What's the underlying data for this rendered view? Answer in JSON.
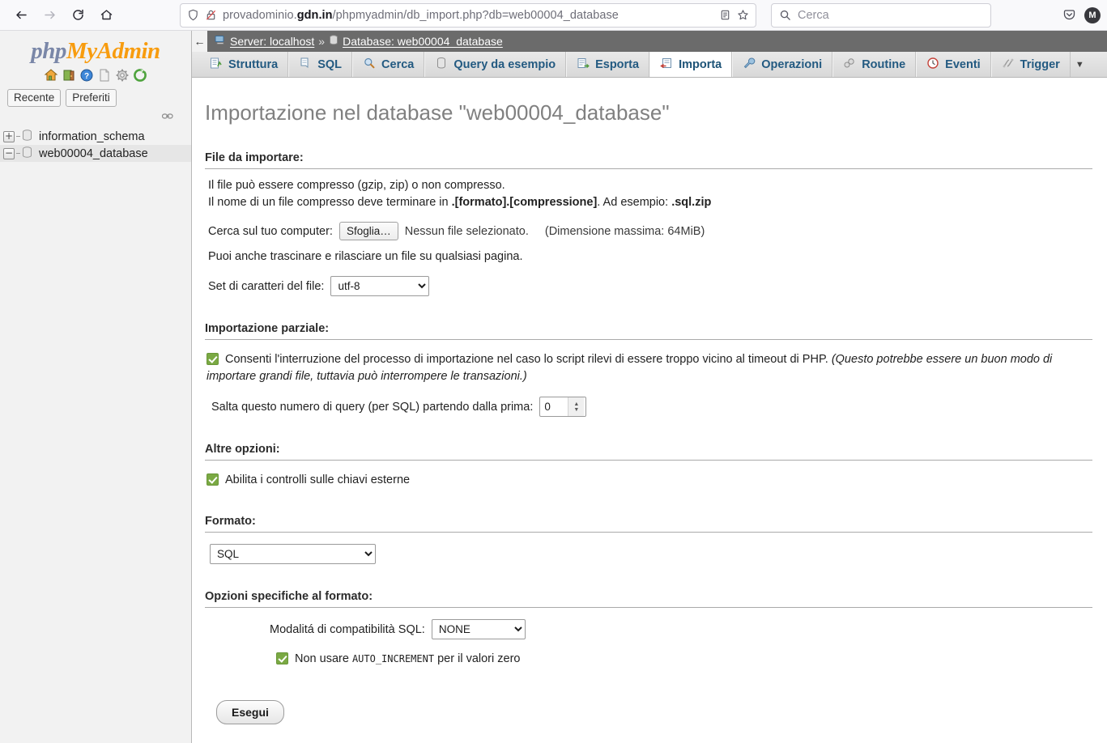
{
  "browser": {
    "back_icon": "arrow-left-icon",
    "forward_icon": "arrow-right-icon",
    "reload_icon": "reload-icon",
    "home_icon": "home-icon",
    "shield_icon": "shield-icon",
    "insecure_icon": "lock-crossed-icon",
    "url_prefix": "provadominio.",
    "url_domain": "gdn.in",
    "url_suffix": "/phpmyadmin/db_import.php?db=web00004_database",
    "reader_icon": "reader-view-icon",
    "bookmark_icon": "star-icon",
    "search_icon": "search-icon",
    "search_placeholder": "Cerca",
    "pocket_icon": "pocket-icon",
    "avatar_initial": "M"
  },
  "sidebar": {
    "logo_php": "php",
    "logo_myadmin": "MyAdmin",
    "nav_icons": [
      "home-icon",
      "logout-icon",
      "help-icon",
      "docs-icon",
      "settings-gear-icon",
      "refresh-icon"
    ],
    "quick_buttons": [
      {
        "label": "Recente"
      },
      {
        "label": "Preferiti"
      }
    ],
    "link_icon": "chain-link-icon",
    "databases": [
      {
        "name": "information_schema",
        "expander": "+",
        "selected": false
      },
      {
        "name": "web00004_database",
        "expander": "−",
        "selected": true
      }
    ]
  },
  "breadcrumb": {
    "back_arrow": "←",
    "server_icon": "server-icon",
    "server_label": "Server: localhost",
    "separator": "»",
    "database_icon": "database-icon",
    "database_label": "Database: web00004_database"
  },
  "tabs": [
    {
      "label": "Struttura",
      "icon": "structure-icon",
      "active": false
    },
    {
      "label": "SQL",
      "icon": "sql-icon",
      "active": false
    },
    {
      "label": "Cerca",
      "icon": "search-icon",
      "active": false
    },
    {
      "label": "Query da esempio",
      "icon": "query-icon",
      "active": false
    },
    {
      "label": "Esporta",
      "icon": "export-icon",
      "active": false
    },
    {
      "label": "Importa",
      "icon": "import-icon",
      "active": true
    },
    {
      "label": "Operazioni",
      "icon": "wrench-icon",
      "active": false
    },
    {
      "label": "Routine",
      "icon": "routine-icon",
      "active": false
    },
    {
      "label": "Eventi",
      "icon": "event-clock-icon",
      "active": false
    },
    {
      "label": "Trigger",
      "icon": "trigger-icon",
      "active": false
    }
  ],
  "tab_overflow_icon": "chevron-down-icon",
  "main": {
    "page_title": "Importazione nel database \"web00004_database\"",
    "file_section": {
      "legend": "File da importare:",
      "info_line_1": "Il file può essere compresso (gzip, zip) o non compresso.",
      "info_line_2_a": "Il nome di un file compresso deve terminare in ",
      "info_line_2_b": ".[formato].[compressione]",
      "info_line_2_c": ". Ad esempio: ",
      "info_line_2_d": ".sql.zip",
      "browse_label": "Cerca sul tuo computer:",
      "browse_button": "Sfoglia…",
      "no_file": "Nessun file selezionato.",
      "max_size": "(Dimensione massima: 64MiB)",
      "drag_hint": "Puoi anche trascinare e rilasciare un file su qualsiasi pagina.",
      "charset_label": "Set di caratteri del file:",
      "charset_value": "utf-8"
    },
    "partial_section": {
      "legend": "Importazione parziale:",
      "allow_interrupt_text": "Consenti l'interruzione del processo di importazione nel caso lo script rilevi di essere troppo vicino al timeout di PHP.",
      "allow_interrupt_italic": "(Questo potrebbe essere un buon modo di importare grandi file, tuttavia può interrompere le transazioni.)",
      "allow_interrupt_checked": true,
      "skip_label": "Salta questo numero di query (per SQL) partendo dalla prima:",
      "skip_value": "0"
    },
    "other_section": {
      "legend": "Altre opzioni:",
      "foreign_keys_label": "Abilita i controlli sulle chiavi esterne",
      "foreign_keys_checked": true
    },
    "format_section": {
      "legend": "Formato:",
      "format_value": "SQL"
    },
    "format_options_section": {
      "legend": "Opzioni specifiche al formato:",
      "compat_label": "Modalitá di compatibilità SQL:",
      "compat_value": "NONE",
      "auto_increment_prefix": "Non usare ",
      "auto_increment_mono": "AUTO_INCREMENT",
      "auto_increment_suffix": " per il valori zero",
      "auto_increment_checked": true
    },
    "submit_label": "Esegui"
  },
  "colors": {
    "tab_text": "#235a81",
    "checkbox_green": "#7aa943",
    "logo_orange": "#f89c0e",
    "breadcrumb_bg": "#6b6b6b"
  }
}
